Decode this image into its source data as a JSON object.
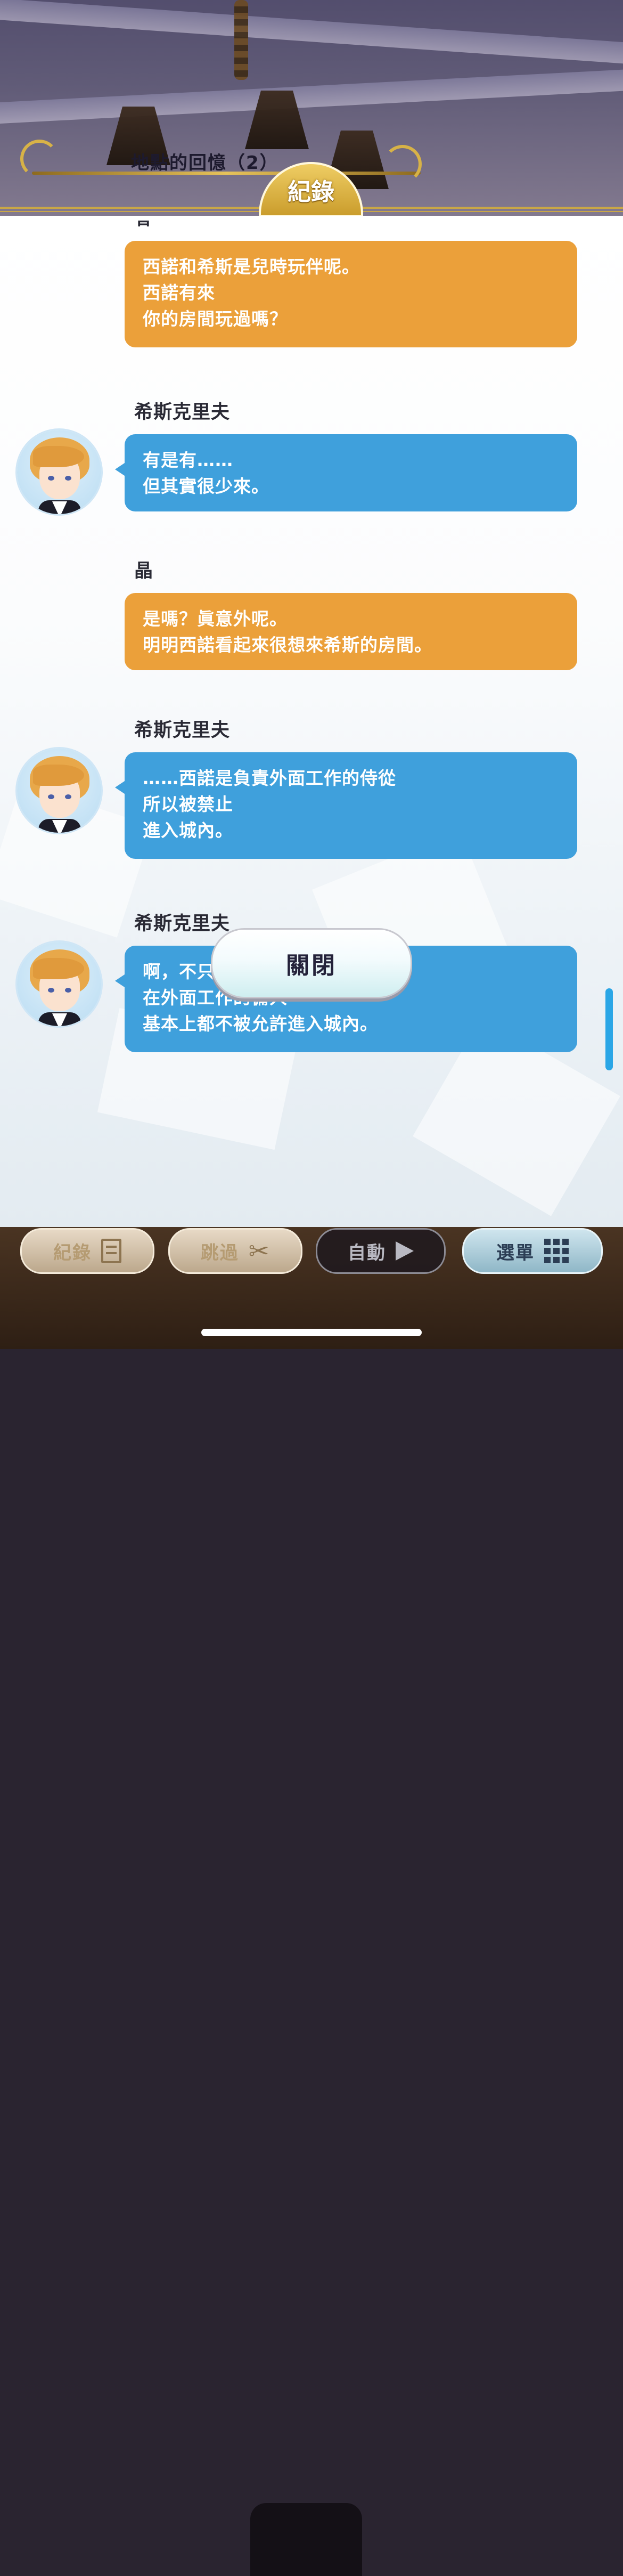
{
  "header": {
    "title": "地點的回憶（2）",
    "tab_label": "紀錄"
  },
  "log": {
    "cut_off_speaker": "晶",
    "entries": [
      {
        "speaker": "",
        "color": "orange",
        "lines": [
          "西諾和希斯是兒時玩伴呢。",
          "西諾有來",
          "你的房間玩過嗎？"
        ]
      },
      {
        "speaker": "希斯克里夫",
        "color": "blue",
        "lines": [
          "有是有……",
          "但其實很少來。"
        ]
      },
      {
        "speaker": "晶",
        "color": "orange",
        "lines": [
          "是嗎？眞意外呢。",
          "明明西諾看起來很想來希斯的房間。"
        ]
      },
      {
        "speaker": "希斯克里夫",
        "color": "blue",
        "lines": [
          "……西諾是負責外面工作的侍從",
          "所以被禁止",
          "進入城內。"
        ]
      },
      {
        "speaker": "希斯克里夫",
        "color": "blue",
        "lines": [
          "啊，不只是西諾，",
          "在外面工作的傭人",
          "基本上都不被允許進入城內。"
        ]
      }
    ]
  },
  "close_button": "關閉",
  "toolbar": {
    "log_label": "紀錄",
    "skip_label": "跳過",
    "auto_label": "自動",
    "menu_label": "選單"
  },
  "colors": {
    "orange_bubble": "#eba03a",
    "blue_bubble": "#3fa0dc",
    "gold": "#d7b247"
  }
}
